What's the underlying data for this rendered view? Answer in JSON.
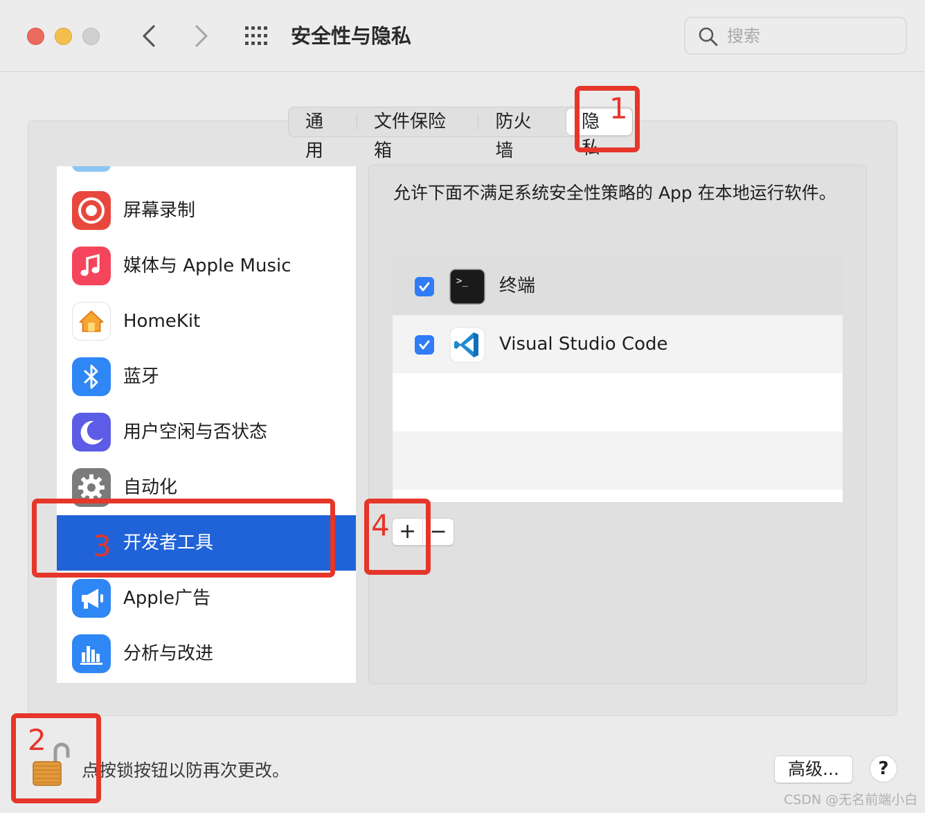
{
  "window": {
    "title": "安全性与隐私",
    "search_placeholder": "搜索"
  },
  "tabs": [
    "通用",
    "文件保险箱",
    "防火墙",
    "隐私"
  ],
  "active_tab": "隐私",
  "sidebar": {
    "items": [
      {
        "label": "屏幕录制",
        "icon": "screen-record-icon"
      },
      {
        "label": "媒体与 Apple Music",
        "icon": "music-note-icon"
      },
      {
        "label": "HomeKit",
        "icon": "home-icon"
      },
      {
        "label": "蓝牙",
        "icon": "bluetooth-icon"
      },
      {
        "label": "用户空闲与否状态",
        "icon": "moon-icon"
      },
      {
        "label": "自动化",
        "icon": "gear-icon"
      },
      {
        "label": "开发者工具",
        "icon": "developer-tools-icon",
        "selected": true
      },
      {
        "label": "Apple广告",
        "icon": "megaphone-icon"
      },
      {
        "label": "分析与改进",
        "icon": "bar-chart-icon"
      }
    ]
  },
  "main": {
    "description": "允许下面不满足系统安全性策略的 App 在本地运行软件。",
    "apps": [
      {
        "name": "终端",
        "checked": true,
        "icon": "terminal-icon"
      },
      {
        "name": "Visual Studio Code",
        "checked": true,
        "icon": "vscode-icon"
      }
    ],
    "add_label": "+",
    "remove_label": "−"
  },
  "footer": {
    "lock_text": "点按锁按钮以防再次更改。",
    "advanced_label": "高级...",
    "help_label": "?"
  },
  "annotations": [
    "1",
    "2",
    "3",
    "4"
  ],
  "watermark": "CSDN @无名前端小白",
  "colors": {
    "accent": "#2063d8",
    "annotation": "#e5362a",
    "checkbox": "#2f7cf6"
  }
}
